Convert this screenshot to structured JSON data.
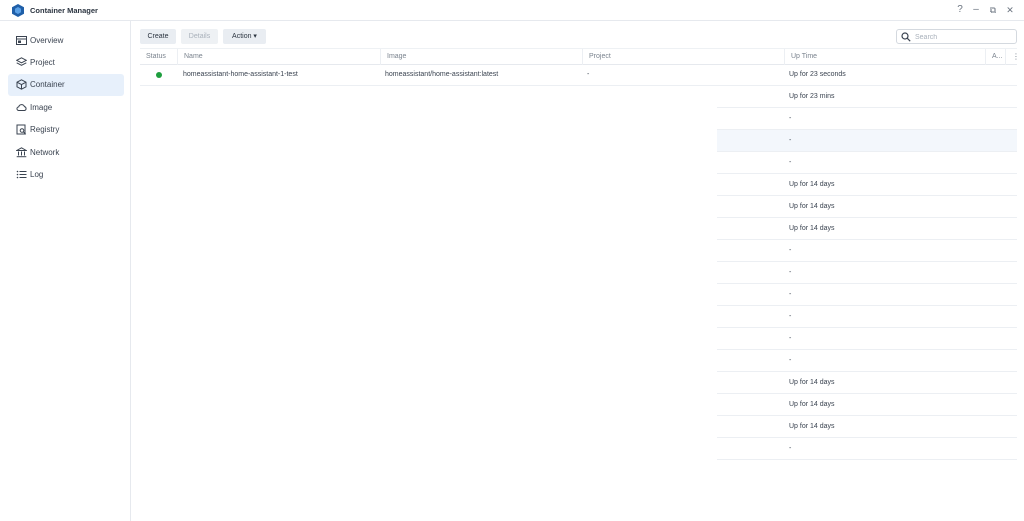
{
  "app": {
    "title": "Container Manager"
  },
  "window_controls": {
    "help": "?",
    "minimize": "–",
    "restore": "⧉",
    "close": "✕"
  },
  "sidebar": {
    "items": [
      {
        "label": "Overview",
        "icon": "overview-icon",
        "active": false
      },
      {
        "label": "Project",
        "icon": "project-icon",
        "active": false
      },
      {
        "label": "Container",
        "icon": "container-icon",
        "active": true
      },
      {
        "label": "Image",
        "icon": "cloud-icon",
        "active": false
      },
      {
        "label": "Registry",
        "icon": "registry-icon",
        "active": false
      },
      {
        "label": "Network",
        "icon": "network-icon",
        "active": false
      },
      {
        "label": "Log",
        "icon": "log-icon",
        "active": false
      }
    ]
  },
  "toolbar": {
    "create_label": "Create",
    "details_label": "Details",
    "action_label": "Action ▾"
  },
  "search": {
    "placeholder": "Search",
    "value": ""
  },
  "table": {
    "columns": [
      "Status",
      "Name",
      "Image",
      "Project",
      "Up Time",
      "A..."
    ],
    "rows": [
      {
        "status": "running",
        "name": "homeassistant-home-assistant-1-test",
        "image": "homeassistant/home-assistant:latest",
        "project": "-",
        "uptime": "Up for 23 seconds"
      },
      {
        "uptime": "Up for 23 mins"
      },
      {
        "uptime": "-"
      },
      {
        "uptime": "-"
      },
      {
        "uptime": "-"
      },
      {
        "uptime": "Up for 14 days"
      },
      {
        "uptime": "Up for 14 days"
      },
      {
        "uptime": "Up for 14 days"
      },
      {
        "uptime": "-"
      },
      {
        "uptime": "-"
      },
      {
        "uptime": "-"
      },
      {
        "uptime": "-"
      },
      {
        "uptime": "-"
      },
      {
        "uptime": "-"
      },
      {
        "uptime": "Up for 14 days"
      },
      {
        "uptime": "Up for 14 days"
      },
      {
        "uptime": "Up for 14 days"
      },
      {
        "uptime": "-"
      }
    ]
  },
  "colors": {
    "accent": "#e7f0fb",
    "running": "#1e9e3e",
    "logo": "#1f5fa8"
  }
}
